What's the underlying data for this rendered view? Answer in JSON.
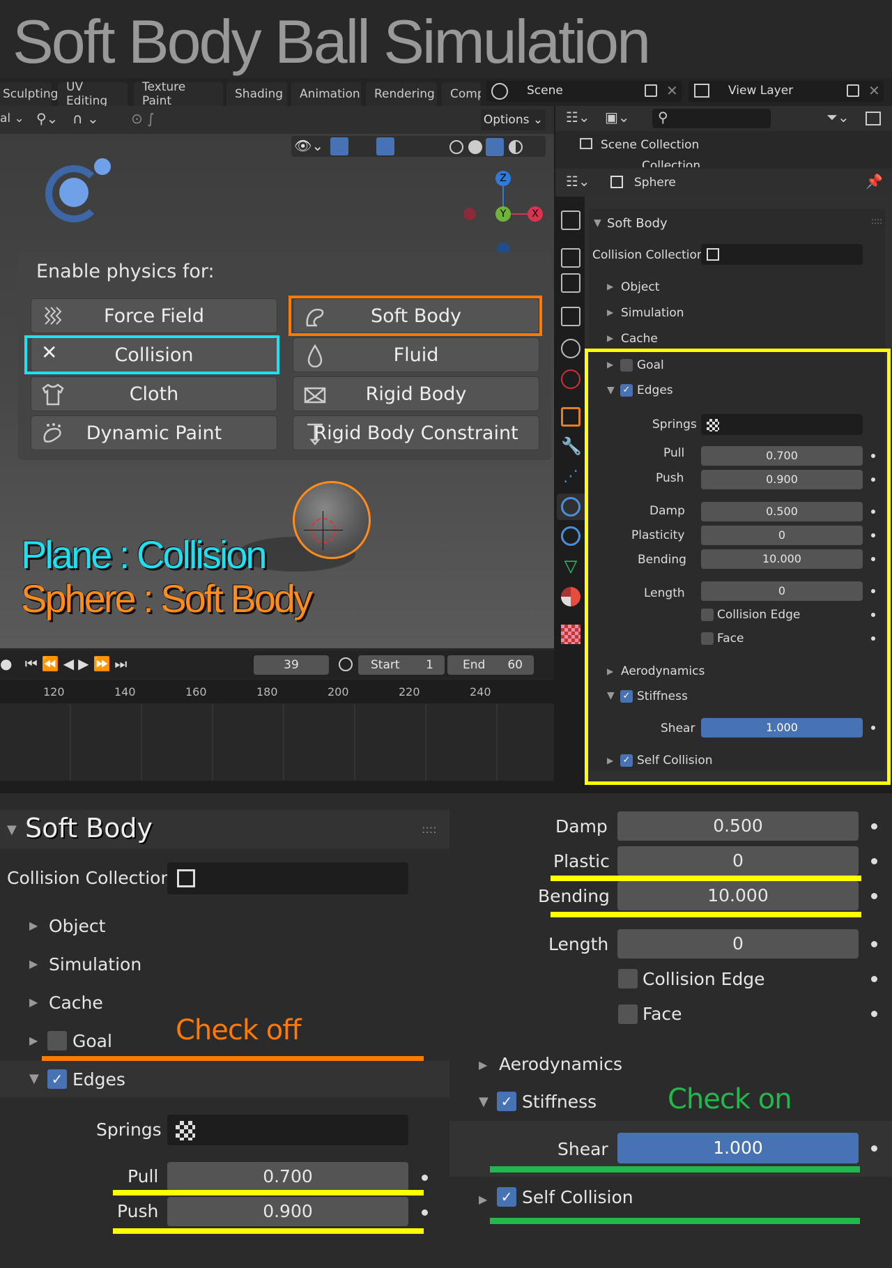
{
  "title": "Soft Body Ball Simulation",
  "workspaces": [
    "Sculpting",
    "UV Editing",
    "Texture Paint",
    "Shading",
    "Animation",
    "Rendering",
    "Comp"
  ],
  "scene": {
    "label": "Scene",
    "view_layer": "View Layer"
  },
  "viewport": {
    "options_label": "Options",
    "enable_label": "Enable physics for:",
    "buttons": {
      "force_field": "Force Field",
      "soft_body": "Soft Body",
      "collision": "Collision",
      "fluid": "Fluid",
      "cloth": "Cloth",
      "rigid_body": "Rigid Body",
      "dynamic_paint": "Dynamic Paint",
      "rigid_body_constraint": "Rigid Body Constraint"
    },
    "gizmo": {
      "z": "Z",
      "y": "Y",
      "x": "X"
    },
    "annotation_plane": "Plane : Collision",
    "annotation_sphere": "Sphere : Soft Body"
  },
  "outliner": {
    "scene_collection": "Scene Collection",
    "collection": "Collection"
  },
  "properties": {
    "object_name": "Sphere",
    "panel_title": "Soft Body",
    "collision_collection_label": "Collision Collection",
    "object": "Object",
    "simulation": "Simulation",
    "cache": "Cache",
    "goal": "Goal",
    "edges": "Edges",
    "springs_label": "Springs",
    "pull_label": "Pull",
    "pull_value": "0.700",
    "push_label": "Push",
    "push_value": "0.900",
    "damp_label": "Damp",
    "damp_value": "0.500",
    "plasticity_label": "Plasticity",
    "plasticity_value": "0",
    "bending_label": "Bending",
    "bending_value": "10.000",
    "length_label": "Length",
    "length_value": "0",
    "collision_edge": "Collision Edge",
    "face": "Face",
    "aerodynamics": "Aerodynamics",
    "stiffness": "Stiffness",
    "shear_label": "Shear",
    "shear_value": "1.000",
    "self_collision": "Self Collision"
  },
  "timeline": {
    "frame": "39",
    "start_label": "Start",
    "start_value": "1",
    "end_label": "End",
    "end_value": "60",
    "ruler": [
      "120",
      "140",
      "160",
      "180",
      "200",
      "220",
      "240"
    ]
  },
  "zoom": {
    "panel_title": "Soft Body",
    "collision_collection_label": "Collision Collection",
    "object": "Object",
    "simulation": "Simulation",
    "cache": "Cache",
    "goal": "Goal",
    "edges": "Edges",
    "springs_label": "Springs",
    "pull_label": "Pull",
    "pull_value": "0.700",
    "push_label": "Push",
    "push_value": "0.900",
    "damp_label": "Damp",
    "damp_value": "0.500",
    "plastic_label": "Plastic",
    "plastic_value": "0",
    "bending_label": "Bending",
    "bending_value": "10.000",
    "length_label": "Length",
    "length_value": "0",
    "collision_edge": "Collision Edge",
    "face": "Face",
    "aerodynamics": "Aerodynamics",
    "stiffness": "Stiffness",
    "shear_label": "Shear",
    "shear_value": "1.000",
    "self_collision": "Self Collision",
    "check_off": "Check off",
    "check_on": "Check on"
  },
  "colors": {
    "orange": "#ff7a00",
    "cyan": "#1fe0f0",
    "yellow": "#ffff00",
    "green": "#22b84a",
    "blender_blue": "#4772b3"
  }
}
